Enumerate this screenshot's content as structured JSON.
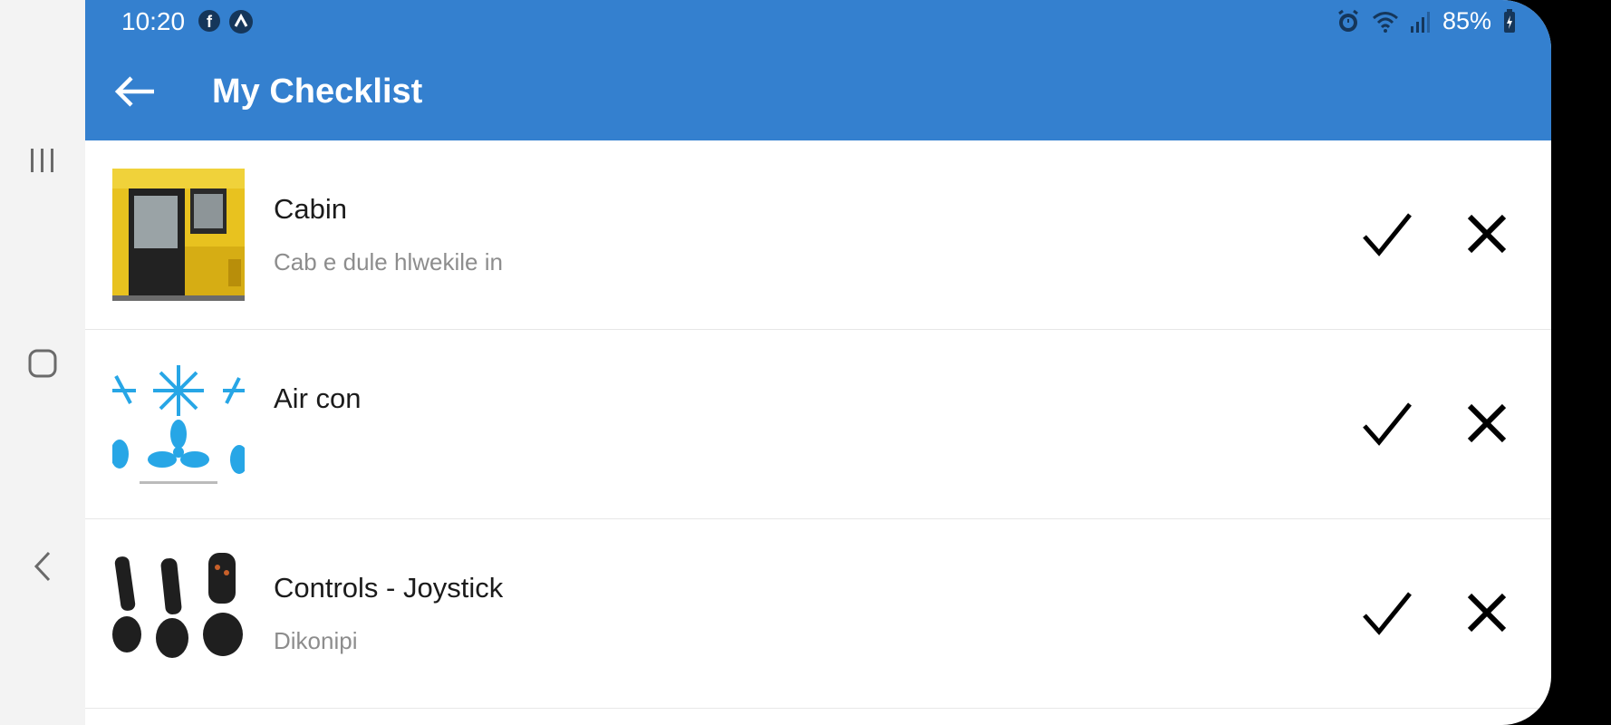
{
  "status_bar": {
    "time": "10:20",
    "battery": "85%"
  },
  "app_bar": {
    "title": "My Checklist"
  },
  "checklist": {
    "items": [
      {
        "title": "Cabin",
        "subtitle": "Cab e dule hlwekile in",
        "image": "cabin-photo"
      },
      {
        "title": "Air con",
        "subtitle": "",
        "image": "snowflake-fan-photo"
      },
      {
        "title": "Controls - Joystick",
        "subtitle": "Dikonipi",
        "image": "joystick-photo"
      }
    ]
  },
  "colors": {
    "app_bar": "#3480cf",
    "title_text": "#ffffff",
    "subtitle_text": "#8d8d8d"
  }
}
